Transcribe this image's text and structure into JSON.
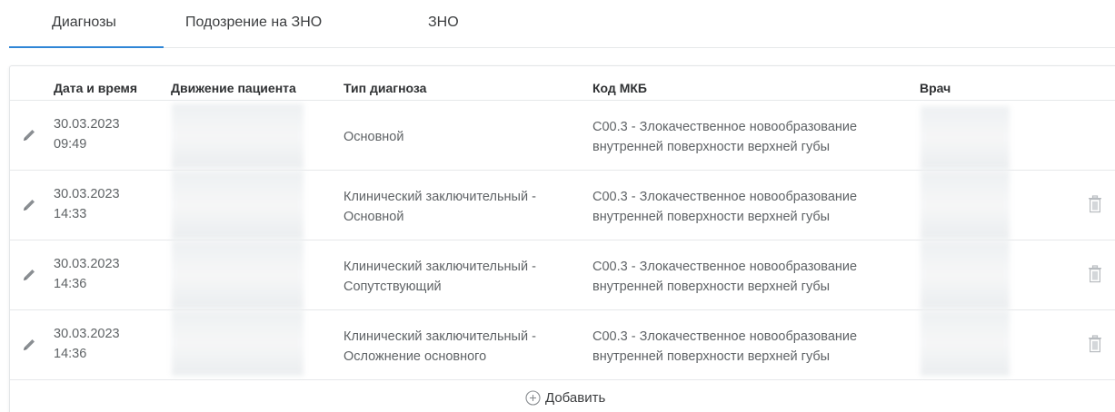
{
  "tabs": [
    {
      "label": "Диагнозы",
      "active": true
    },
    {
      "label": "Подозрение на ЗНО",
      "active": false
    },
    {
      "label": "ЗНО",
      "active": false
    }
  ],
  "table": {
    "columns": {
      "date": "Дата и время",
      "movement": "Движение пациента",
      "type": "Тип диагноза",
      "code": "Код МКБ",
      "doctor": "Врач"
    },
    "rows": [
      {
        "date": "30.03.2023",
        "time": "09:49",
        "type_line1": "Основной",
        "type_line2": "",
        "code_line1": "C00.3 - Злокачественное новообразование",
        "code_line2": "внутренней поверхности верхней губы",
        "deletable": false
      },
      {
        "date": "30.03.2023",
        "time": "14:33",
        "type_line1": "Клинический заключительный -",
        "type_line2": "Основной",
        "code_line1": "C00.3 - Злокачественное новообразование",
        "code_line2": "внутренней поверхности верхней губы",
        "deletable": true
      },
      {
        "date": "30.03.2023",
        "time": "14:36",
        "type_line1": "Клинический заключительный -",
        "type_line2": "Сопутствующий",
        "code_line1": "C00.3 - Злокачественное новообразование",
        "code_line2": "внутренней поверхности верхней губы",
        "deletable": true
      },
      {
        "date": "30.03.2023",
        "time": "14:36",
        "type_line1": "Клинический заключительный -",
        "type_line2": "Осложнение основного",
        "code_line1": "C00.3 - Злокачественное новообразование",
        "code_line2": "внутренней поверхности верхней губы",
        "deletable": true
      }
    ]
  },
  "add_label": "Добавить",
  "icons": {
    "edit": "pencil-icon",
    "delete": "trash-icon",
    "add": "plus-circle-icon"
  },
  "colors": {
    "accent": "#2f86d6",
    "text_muted": "#5f6366",
    "border": "#e6e8ea"
  }
}
